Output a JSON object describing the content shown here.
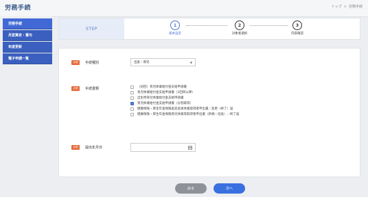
{
  "header": {
    "title": "労務手続",
    "breadcrumb": [
      "トップ",
      ">",
      "労務手続"
    ]
  },
  "sidebar": {
    "items": [
      {
        "label": "労務手続"
      },
      {
        "label": "月変算定・賞与"
      },
      {
        "label": "年度更新"
      },
      {
        "label": "電子申請一覧"
      }
    ]
  },
  "steps": {
    "label": "STEP",
    "items": [
      {
        "number": "1",
        "name": "基本設定"
      },
      {
        "number": "2",
        "name": "対象者選択"
      },
      {
        "number": "3",
        "name": "内容確認"
      }
    ]
  },
  "form": {
    "required_badge": "必須",
    "procedure_type": {
      "label": "手続種別",
      "value": "出産・育児"
    },
    "documents": {
      "label": "手続書類",
      "options": [
        {
          "label": "（初回）育児休業給付金支給申請書",
          "checked": false
        },
        {
          "label": "育児休業給付金支給申請書（2回目以降）",
          "checked": false
        },
        {
          "label": "出生時育児休業給付金支給申請書",
          "checked": false
        },
        {
          "label": "育児休業給付金支給申請書（分割取得）",
          "checked": true
        },
        {
          "label": "健康保険・厚生年金保険産前産後休業取得者申出書／変更（終了）届",
          "checked": false
        },
        {
          "label": "健康保険・厚生年金保険育児休業等取得者申出書（新規・延長）／終了届",
          "checked": false
        }
      ]
    },
    "submit_date": {
      "label": "提出年月日",
      "value": ""
    }
  },
  "buttons": {
    "back": "戻る",
    "next": "次へ"
  }
}
